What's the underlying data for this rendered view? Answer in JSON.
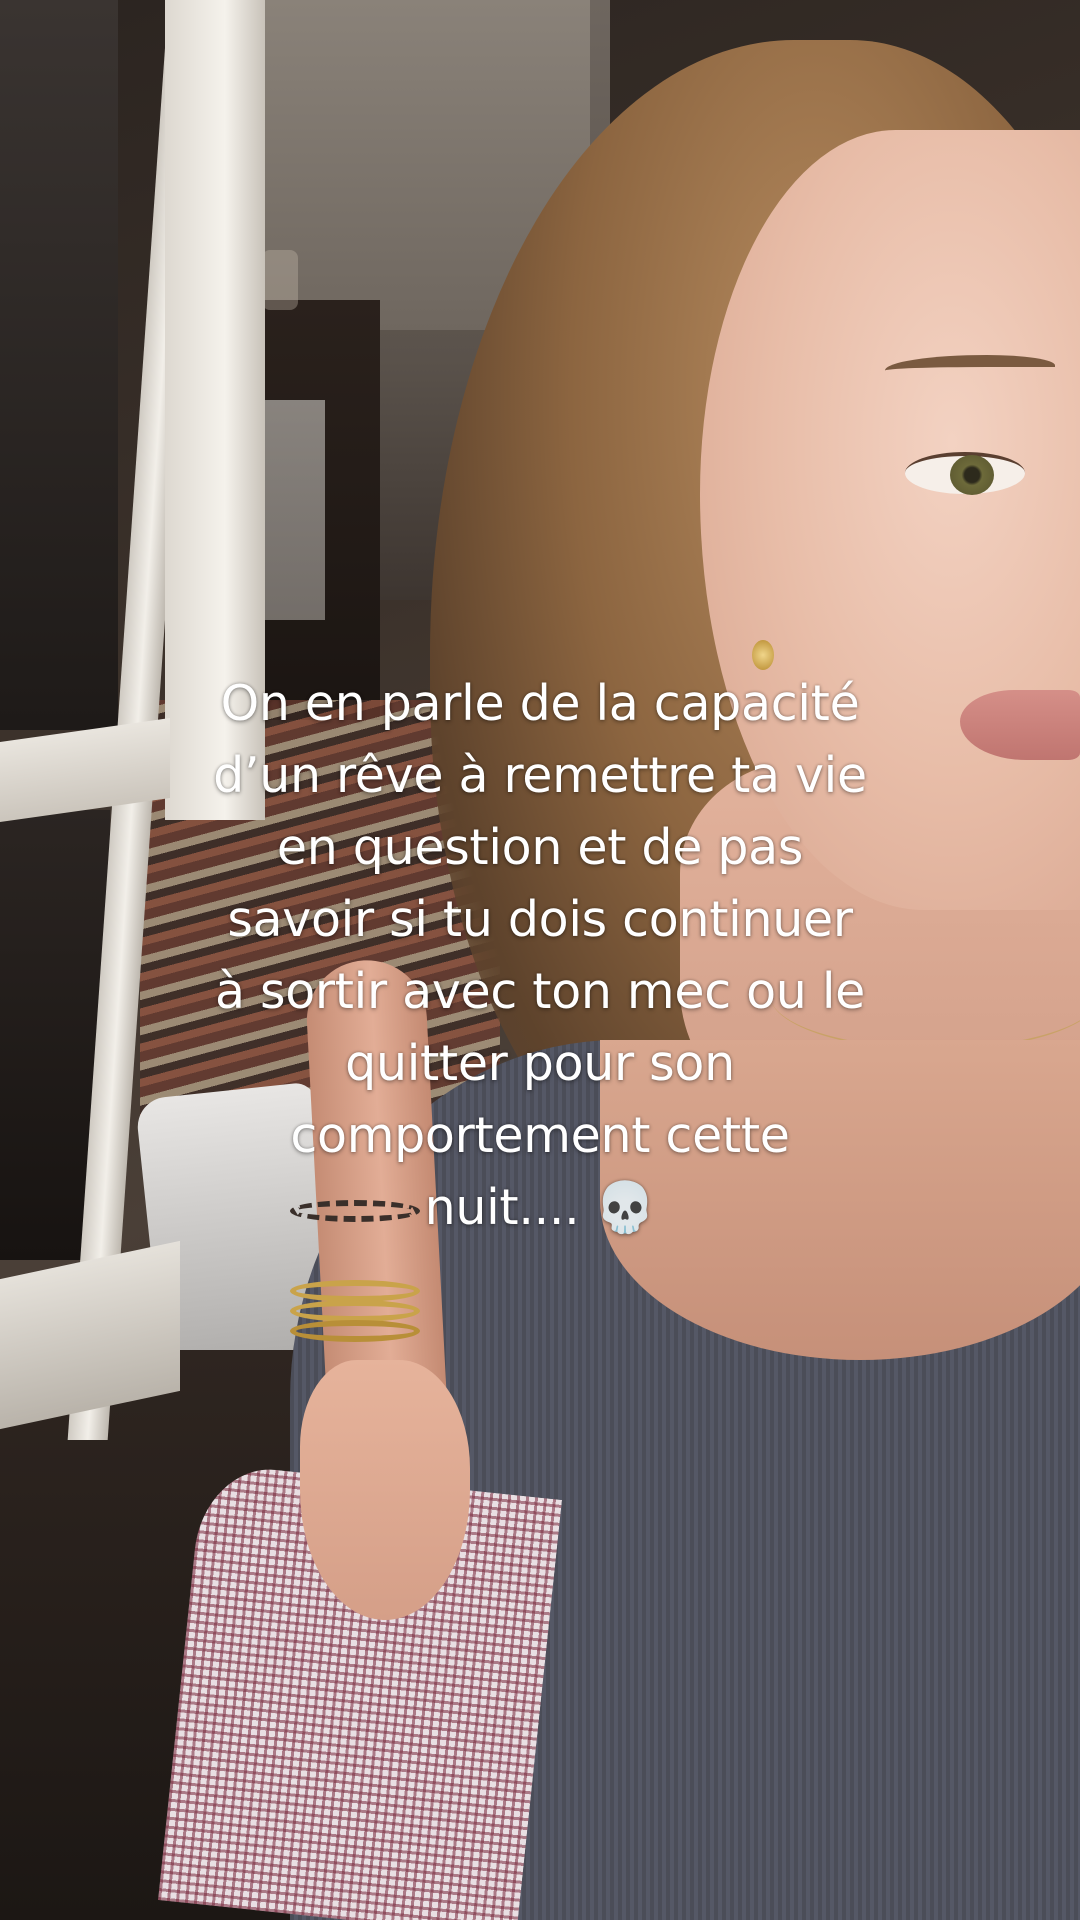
{
  "caption": {
    "lines": [
      "On en parle de la capacité",
      "d’un rêve à remettre ta vie",
      "en question et de pas",
      "savoir si tu dois continuer",
      "à sortir avec ton mec ou le",
      "quitter pour son",
      "comportement cette",
      "nuit.... 💀"
    ]
  }
}
